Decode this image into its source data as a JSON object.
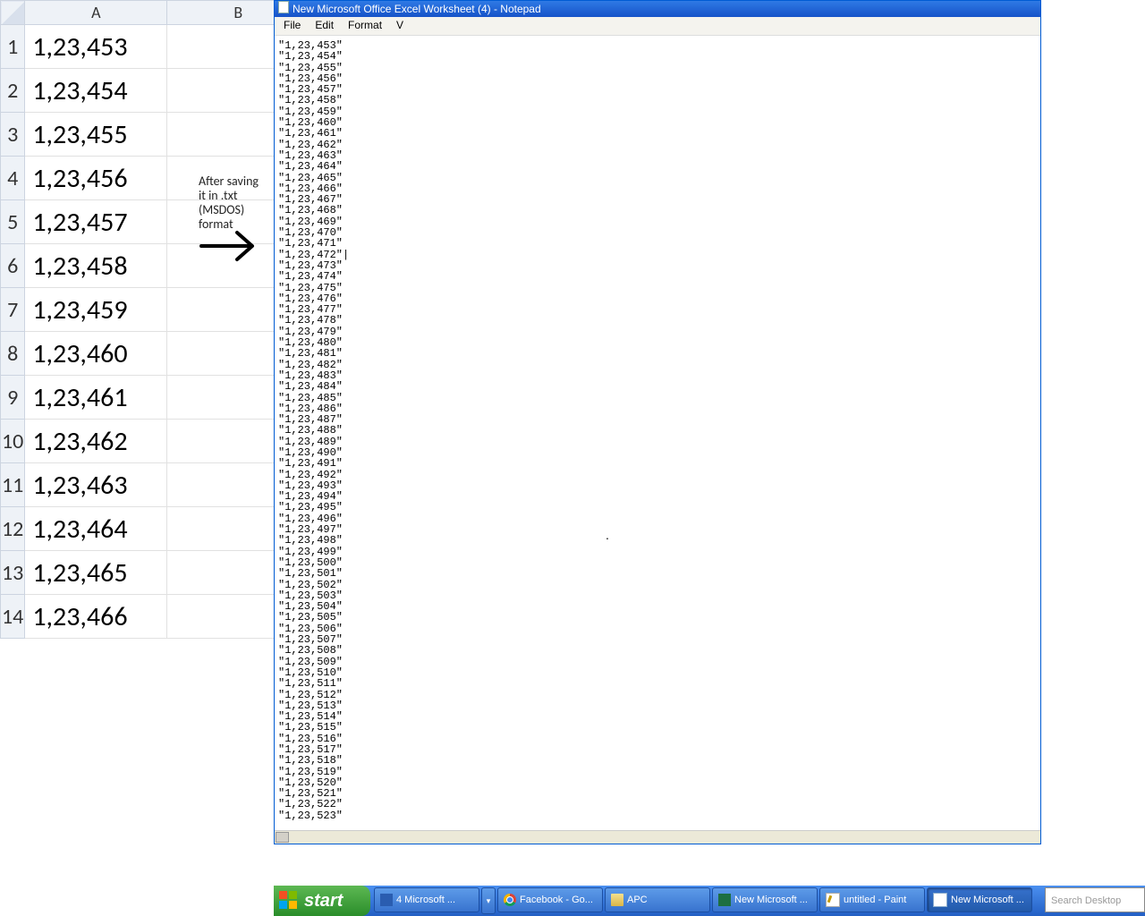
{
  "excel": {
    "col_headers": [
      "A",
      "B"
    ],
    "rows": [
      {
        "n": "1",
        "a": "1,23,453"
      },
      {
        "n": "2",
        "a": "1,23,454"
      },
      {
        "n": "3",
        "a": "1,23,455"
      },
      {
        "n": "4",
        "a": "1,23,456"
      },
      {
        "n": "5",
        "a": "1,23,457"
      },
      {
        "n": "6",
        "a": "1,23,458"
      },
      {
        "n": "7",
        "a": "1,23,459"
      },
      {
        "n": "8",
        "a": "1,23,460"
      },
      {
        "n": "9",
        "a": "1,23,461"
      },
      {
        "n": "10",
        "a": "1,23,462"
      },
      {
        "n": "11",
        "a": "1,23,463"
      },
      {
        "n": "12",
        "a": "1,23,464"
      },
      {
        "n": "13",
        "a": "1,23,465"
      },
      {
        "n": "14",
        "a": "1,23,466"
      }
    ]
  },
  "annotation": {
    "line1": "After saving",
    "line2": "it in .txt",
    "line3": "(MSDOS)",
    "line4": "format"
  },
  "notepad": {
    "title": "New Microsoft Office Excel Worksheet (4) - Notepad",
    "menu": {
      "file": "File",
      "edit": "Edit",
      "format": "Format",
      "view": "V"
    },
    "start_value": 123453,
    "end_value": 123523
  },
  "taskbar": {
    "start": "start",
    "buttons": [
      {
        "icon": "word",
        "label": "4 Microsoft ..."
      },
      {
        "icon": "chrome",
        "label": "Facebook - Go..."
      },
      {
        "icon": "folder",
        "label": "APC"
      },
      {
        "icon": "excel",
        "label": "New Microsoft ..."
      },
      {
        "icon": "paint",
        "label": "untitled - Paint"
      },
      {
        "icon": "notepad",
        "label": "New Microsoft ...",
        "active": true
      }
    ],
    "search_placeholder": "Search Desktop"
  }
}
